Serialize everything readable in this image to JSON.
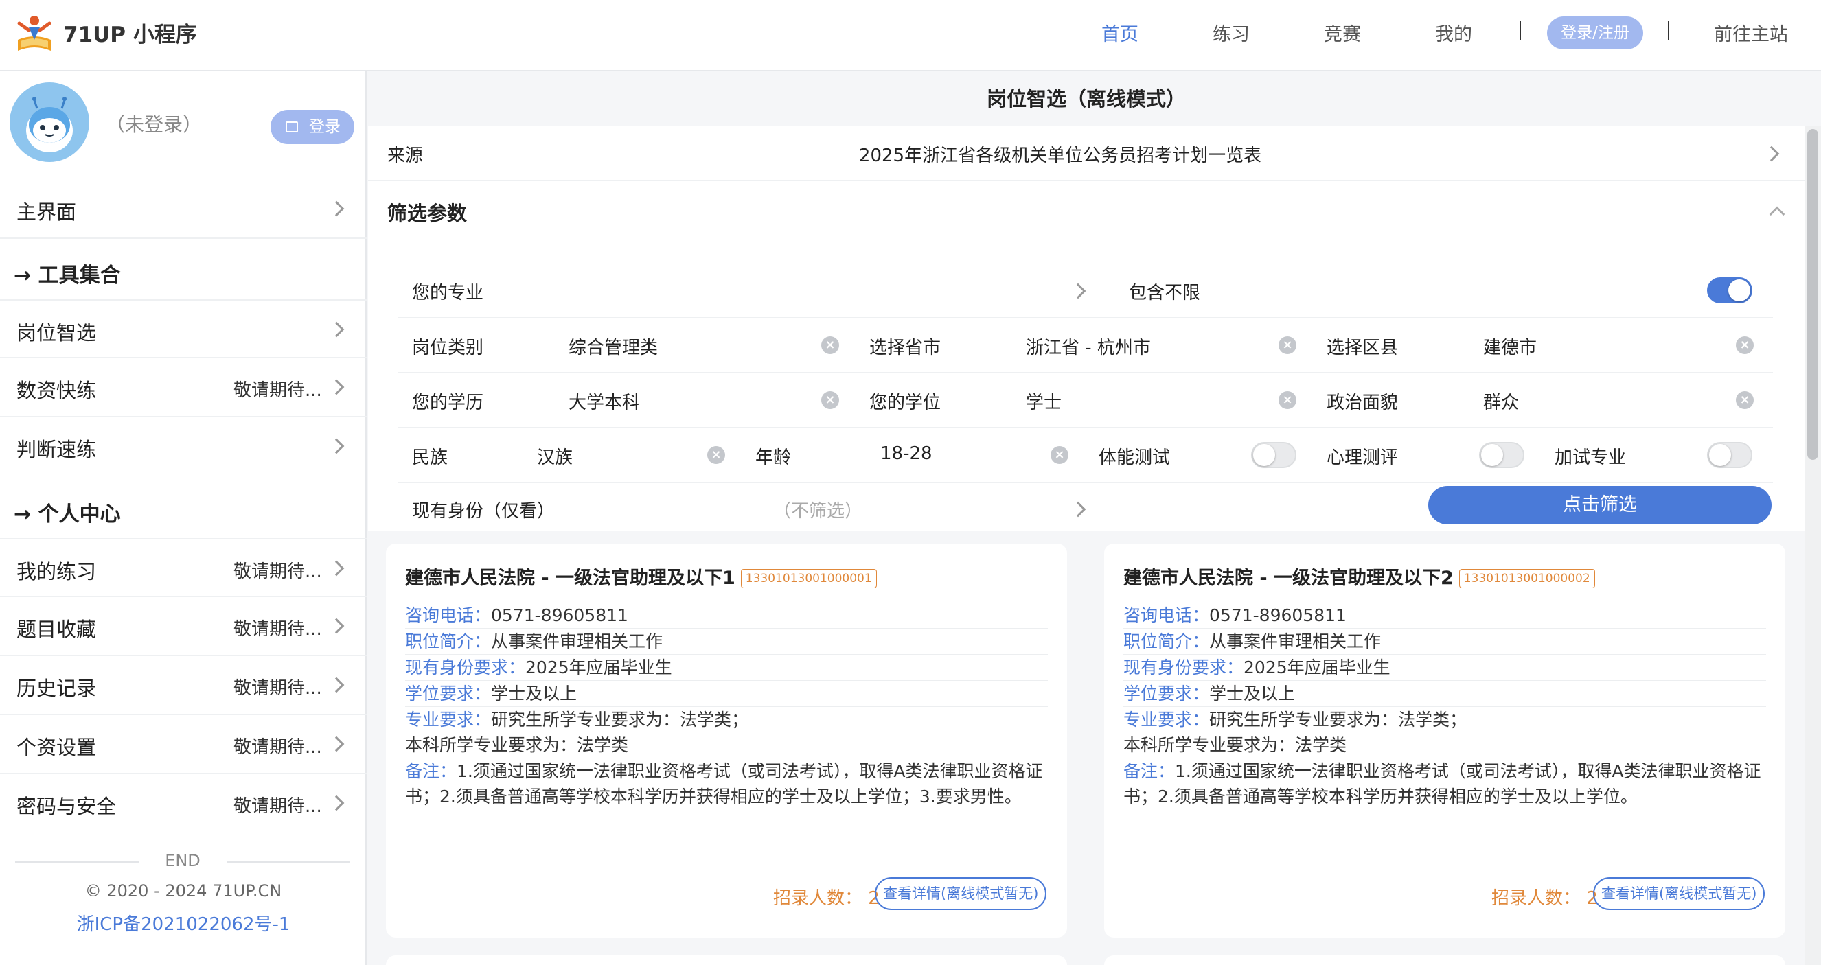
{
  "app": {
    "title": "71UP 小程序"
  },
  "nav": {
    "home": "首页",
    "practice": "练习",
    "contest": "竞赛",
    "mine": "我的",
    "login_register": "登录/注册",
    "main_site": "前往主站"
  },
  "sidebar": {
    "user_status": "（未登录）",
    "login_label": "登录",
    "main_ui": "主界面",
    "tools_heading": "→ 工具集合",
    "tools": [
      {
        "label": "岗位智选",
        "aside": ""
      },
      {
        "label": "数资快练",
        "aside": "敬请期待..."
      },
      {
        "label": "判断速练",
        "aside": ""
      }
    ],
    "personal_heading": "→ 个人中心",
    "personal": [
      {
        "label": "我的练习",
        "aside": "敬请期待..."
      },
      {
        "label": "题目收藏",
        "aside": "敬请期待..."
      },
      {
        "label": "历史记录",
        "aside": "敬请期待..."
      },
      {
        "label": "个资设置",
        "aside": "敬请期待..."
      },
      {
        "label": "密码与安全",
        "aside": "敬请期待..."
      }
    ],
    "end_label": "END",
    "copyright": "© 2020 - 2024 71UP.CN",
    "icp": "浙ICP备2021022062号-1"
  },
  "page": {
    "title": "岗位智选（离线模式）",
    "source_label": "来源",
    "source_value": "2025年浙江省各级机关单位公务员招考计划一览表"
  },
  "filter": {
    "title": "筛选参数",
    "major_label": "您的专业",
    "include_unlimited": "包含不限",
    "include_unlimited_on": true,
    "job_type_label": "岗位类别",
    "job_type_value": "综合管理类",
    "province_label": "选择省市",
    "province_value": "浙江省 - 杭州市",
    "district_label": "选择区县",
    "district_value": "建德市",
    "education_label": "您的学历",
    "education_value": "大学本科",
    "degree_label": "您的学位",
    "degree_value": "学士",
    "political_label": "政治面貌",
    "political_value": "群众",
    "ethnicity_label": "民族",
    "ethnicity_value": "汉族",
    "age_label": "年龄",
    "age_value": "18-28",
    "fitness_label": "体能测试",
    "fitness_on": false,
    "psych_label": "心理测评",
    "psych_on": false,
    "extra_label": "加试专业",
    "extra_on": false,
    "identity_label": "现有身份（仅看）",
    "identity_placeholder": "（不筛选）",
    "submit_label": "点击筛选",
    "clear_glyph": "×"
  },
  "cards": [
    {
      "title": "建德市人民法院 - 一级法官助理及以下1",
      "code": "13301013001000001",
      "phone_label": "咨询电话：",
      "phone": "0571-89605811",
      "intro_label": "职位简介：",
      "intro": "从事案件审理相关工作",
      "identity_label": "现有身份要求：",
      "identity": "2025年应届毕业生",
      "degree_label": "学位要求：",
      "degree": "学士及以上",
      "major_label": "专业要求：",
      "major": "研究生所学专业要求为：法学类；",
      "major2": "本科所学专业要求为：法学类",
      "note_label": "备注：",
      "note": "1.须通过国家统一法律职业资格考试（或司法考试），取得A类法律职业资格证",
      "note2": "书；2.须具备普通高等学校本科学历并获得相应的学士及以上学位；3.要求男性。",
      "count_label": "招录人数：",
      "count": "2",
      "detail_label": "查看详情(离线模式暂无)"
    },
    {
      "title": "建德市人民法院 - 一级法官助理及以下2",
      "code": "13301013001000002",
      "phone_label": "咨询电话：",
      "phone": "0571-89605811",
      "intro_label": "职位简介：",
      "intro": "从事案件审理相关工作",
      "identity_label": "现有身份要求：",
      "identity": "2025年应届毕业生",
      "degree_label": "学位要求：",
      "degree": "学士及以上",
      "major_label": "专业要求：",
      "major": "研究生所学专业要求为：法学类；",
      "major2": "本科所学专业要求为：法学类",
      "note_label": "备注：",
      "note": "1.须通过国家统一法律职业资格考试（或司法考试），取得A类法律职业资格证",
      "note2": "书；2.须具备普通高等学校本科学历并获得相应的学士及以上学位。",
      "count_label": "招录人数：",
      "count": "2",
      "detail_label": "查看详情(离线模式暂无)"
    }
  ]
}
